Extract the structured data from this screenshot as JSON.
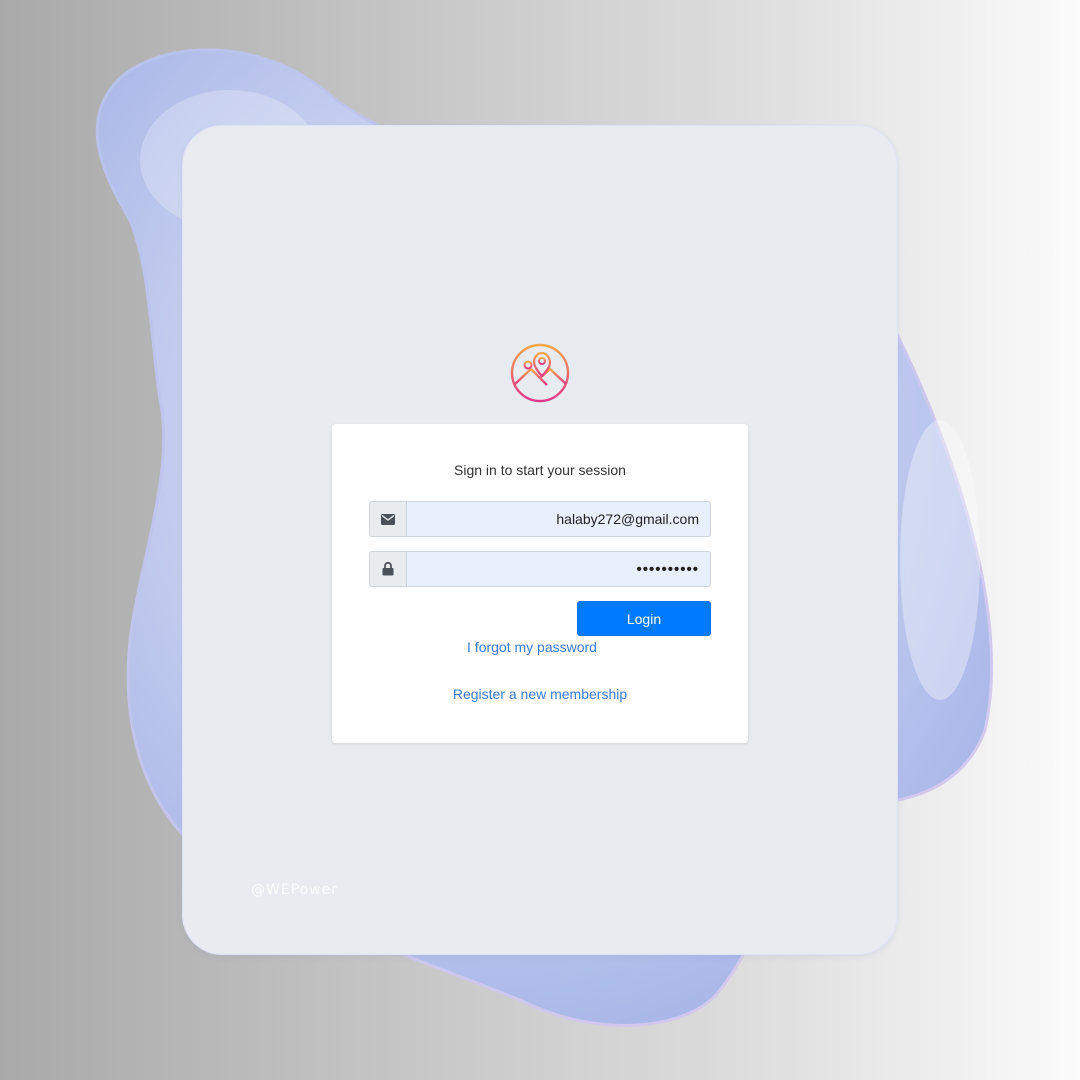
{
  "login": {
    "message": "Sign in to start your session",
    "email_value": "halaby272@gmail.com",
    "password_value": "••••••••••",
    "login_label": "Login",
    "forgot_link": "I forgot my password",
    "register_link": "Register a new membership"
  },
  "icons": {
    "logo": "map-pin-mountain-logo",
    "email": "envelope-icon",
    "password": "lock-icon"
  },
  "watermark": "@WEPower",
  "colors": {
    "primary": "#007bff",
    "link": "#3c7bd0",
    "input_fill": "#e8f0fe",
    "logo_gradient_start": "#f7a84a",
    "logo_gradient_end": "#e0368a"
  }
}
